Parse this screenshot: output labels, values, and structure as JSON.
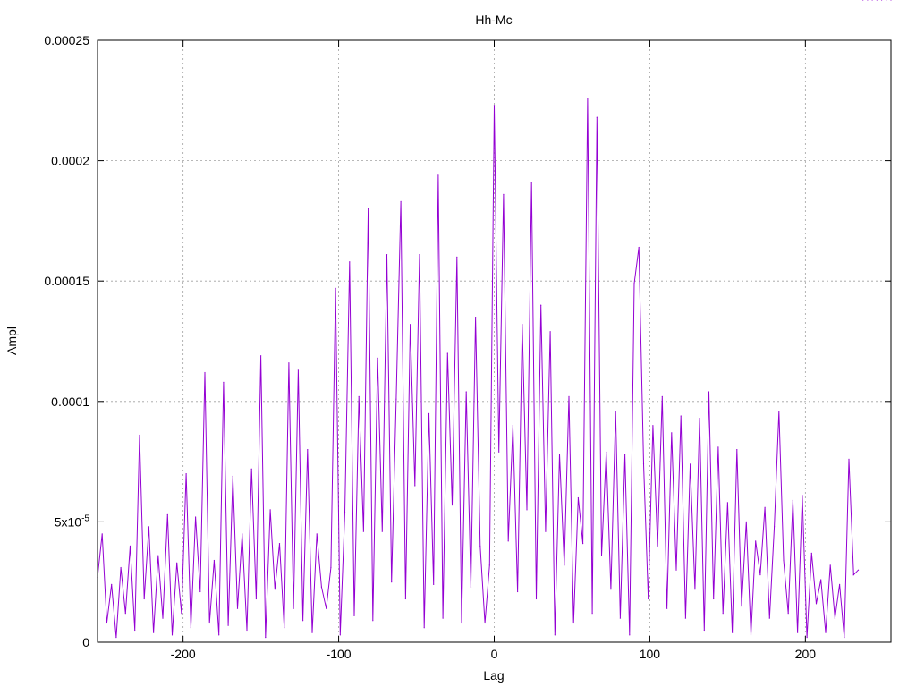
{
  "chart_data": {
    "type": "line",
    "title": "Hh-Mc",
    "xlabel": "Lag",
    "ylabel": "Ampl",
    "xlim": [
      -255,
      255
    ],
    "ylim": [
      0,
      0.00025
    ],
    "grid": true,
    "series_color": "#9400D3",
    "x_ticks": [
      {
        "value": -200,
        "label": "-200"
      },
      {
        "value": -100,
        "label": "-100"
      },
      {
        "value": 0,
        "label": "0"
      },
      {
        "value": 100,
        "label": "100"
      },
      {
        "value": 200,
        "label": "200"
      }
    ],
    "y_ticks": [
      {
        "value": 0,
        "label": "0"
      },
      {
        "value": 5e-05,
        "label": "5x10",
        "sup": "-5"
      },
      {
        "value": 0.0001,
        "label": "0.0001"
      },
      {
        "value": 0.00015,
        "label": "0.00015"
      },
      {
        "value": 0.0002,
        "label": "0.0002"
      },
      {
        "value": 0.00025,
        "label": "0.00025"
      }
    ],
    "x": [
      -255,
      -252,
      -249,
      -246,
      -243,
      -240,
      -237,
      -234,
      -231,
      -228,
      -225,
      -222,
      -219,
      -216,
      -213,
      -210,
      -207,
      -204,
      -201,
      -198,
      -195,
      -192,
      -189,
      -186,
      -183,
      -180,
      -177,
      -174,
      -171,
      -168,
      -165,
      -162,
      -159,
      -156,
      -153,
      -150,
      -147,
      -144,
      -141,
      -138,
      -135,
      -132,
      -129,
      -126,
      -123,
      -120,
      -117,
      -114,
      -111,
      -108,
      -105,
      -102,
      -99,
      -96,
      -93,
      -90,
      -87,
      -84,
      -81,
      -78,
      -75,
      -72,
      -69,
      -66,
      -63,
      -60,
      -57,
      -54,
      -51,
      -48,
      -45,
      -42,
      -39,
      -36,
      -33,
      -30,
      -27,
      -24,
      -21,
      -18,
      -15,
      -12,
      -9,
      -6,
      -3,
      0,
      3,
      6,
      9,
      12,
      15,
      18,
      21,
      24,
      27,
      30,
      33,
      36,
      39,
      42,
      45,
      48,
      51,
      54,
      57,
      60,
      63,
      66,
      69,
      72,
      75,
      78,
      81,
      84,
      87,
      90,
      93,
      96,
      99,
      102,
      105,
      108,
      111,
      114,
      117,
      120,
      123,
      126,
      129,
      132,
      135,
      138,
      141,
      144,
      147,
      150,
      153,
      156,
      159,
      162,
      165,
      168,
      171,
      174,
      177,
      180,
      183,
      186,
      189,
      192,
      195,
      198,
      201,
      204,
      207,
      210,
      213,
      216,
      219,
      222,
      225,
      228,
      231,
      234,
      237,
      240,
      243,
      246,
      249,
      252,
      255
    ],
    "y": [
      2.7e-05,
      4.5e-05,
      8e-06,
      2.4e-05,
      2e-06,
      3.1e-05,
      1.2e-05,
      4e-05,
      5e-06,
      8.6e-05,
      1.8e-05,
      4.8e-05,
      4e-06,
      3.6e-05,
      1e-05,
      5.3e-05,
      3e-06,
      3.3e-05,
      1.2e-05,
      7e-05,
      6e-06,
      5.2e-05,
      2.1e-05,
      0.000112,
      8e-06,
      3.4e-05,
      3e-06,
      0.000108,
      7e-06,
      6.9e-05,
      1.4e-05,
      4.5e-05,
      5e-06,
      7.2e-05,
      1.8e-05,
      0.000119,
      2e-06,
      5.5e-05,
      2.2e-05,
      4.1e-05,
      6e-06,
      0.000116,
      1.4e-05,
      0.000113,
      9e-06,
      8e-05,
      4e-06,
      4.5e-05,
      2.3e-05,
      1.4e-05,
      3.1e-05,
      0.000147,
      3e-06,
      5.4e-05,
      0.000158,
      1.1e-05,
      0.000102,
      4.6e-05,
      0.00018,
      9e-06,
      0.000118,
      4.6e-05,
      0.000161,
      2.5e-05,
      0.000101,
      0.000183,
      1.8e-05,
      0.000132,
      6.5e-05,
      0.000161,
      6e-06,
      9.5e-05,
      2.4e-05,
      0.000194,
      1e-05,
      0.00012,
      5.7e-05,
      0.00016,
      8e-06,
      0.000104,
      2.3e-05,
      0.000135,
      4e-05,
      8e-06,
      3.2e-05,
      0.000223,
      7.9e-05,
      0.000186,
      4.2e-05,
      9e-05,
      2.1e-05,
      0.000132,
      5.5e-05,
      0.000191,
      1.8e-05,
      0.00014,
      4.6e-05,
      0.000129,
      3e-06,
      7.8e-05,
      3.2e-05,
      0.000102,
      8e-06,
      6e-05,
      4.1e-05,
      0.000226,
      1.2e-05,
      0.000218,
      3.6e-05,
      7.9e-05,
      2.2e-05,
      9.6e-05,
      1e-05,
      7.8e-05,
      3e-06,
      0.000149,
      0.000164,
      7.4e-05,
      1.8e-05,
      9e-05,
      4e-05,
      0.000102,
      1.4e-05,
      8.7e-05,
      3e-05,
      9.4e-05,
      1e-05,
      7.4e-05,
      2.2e-05,
      9.3e-05,
      5e-06,
      0.000104,
      1.8e-05,
      8.1e-05,
      1.2e-05,
      5.8e-05,
      4e-06,
      8e-05,
      1.5e-05,
      5e-05,
      3e-06,
      4.2e-05,
      2.8e-05,
      5.6e-05,
      1e-05,
      4.8e-05,
      9.6e-05,
      3.4e-05,
      1.2e-05,
      5.9e-05,
      4e-06,
      6.1e-05,
      2e-06,
      3.7e-05,
      1.6e-05,
      2.6e-05,
      4e-06,
      3.2e-05,
      1e-05,
      2.4e-05,
      2e-06,
      7.6e-05,
      2.8e-05,
      3e-05
    ]
  }
}
